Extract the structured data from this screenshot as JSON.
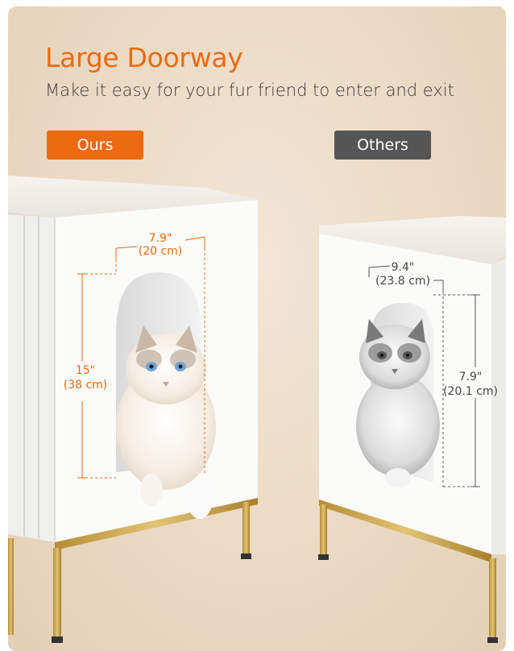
{
  "header": {
    "title": "Large Doorway",
    "subtitle": "Make it easy for your fur friend to enter and exit"
  },
  "labels": {
    "ours": "Ours",
    "others": "Others"
  },
  "ours_dimensions": {
    "width_in": "7.9\"",
    "width_cm": "(20 cm)",
    "height_in": "15\"",
    "height_cm": "(38 cm)"
  },
  "others_dimensions": {
    "width_in": "9.4\"",
    "width_cm": "(23.8 cm)",
    "height_in": "7.9\"",
    "height_cm": "(20.1 cm)"
  },
  "colors": {
    "accent": "#ec6a10",
    "others_tag": "#555555",
    "dimension_gray": "#555555",
    "gold_legs": "#c9a54a"
  }
}
